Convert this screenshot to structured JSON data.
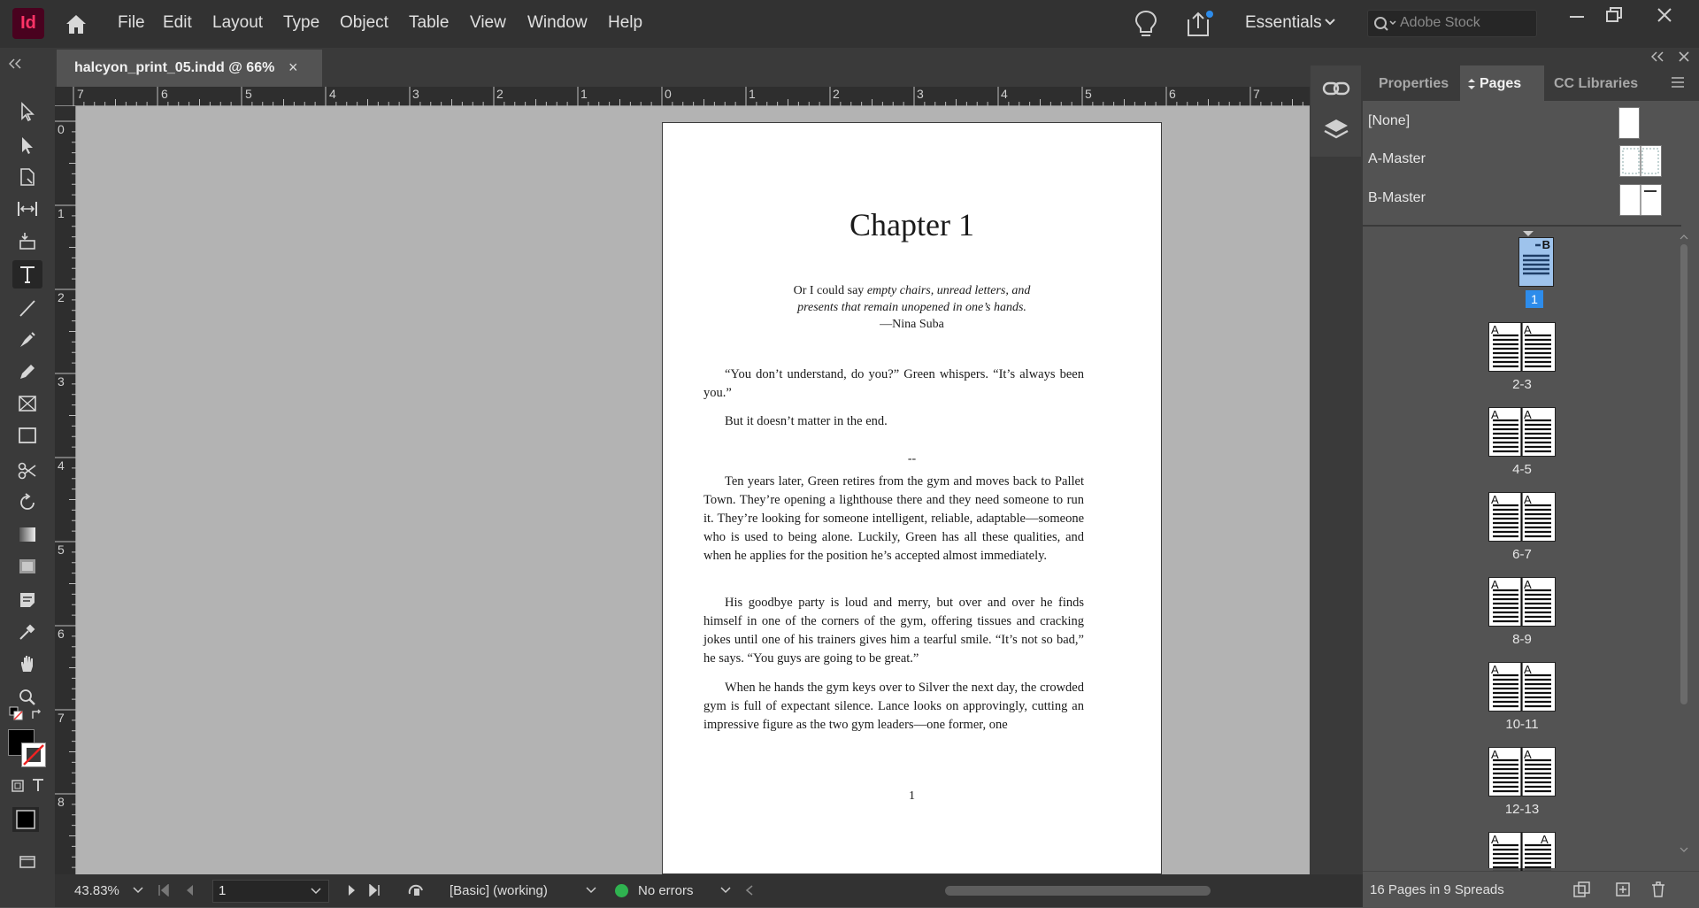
{
  "app": {
    "logo_text": "Id",
    "brand_color": "#ff3366"
  },
  "menu": [
    "File",
    "Edit",
    "Layout",
    "Type",
    "Object",
    "Table",
    "View",
    "Window",
    "Help"
  ],
  "workspace": "Essentials",
  "search": {
    "placeholder": "Adobe Stock"
  },
  "document_tab": {
    "title": "halcyon_print_05.indd @ 66%",
    "close": "×"
  },
  "ruler": {
    "horizontal": [
      "7",
      "6",
      "5",
      "4",
      "3",
      "2",
      "1",
      "0",
      "1",
      "2",
      "3",
      "4",
      "5",
      "6",
      "7"
    ],
    "vertical": [
      "0",
      "1",
      "2",
      "3",
      "4",
      "5",
      "6",
      "7",
      "8"
    ]
  },
  "page": {
    "chapter_title": "Chapter 1",
    "epigraph": {
      "line1_plain": "Or I could say ",
      "line1_italic": "empty chairs, unread letters, and",
      "line2_italic": "presents that remain  unopened in one’s hands.",
      "attribution": "—Nina Suba"
    },
    "paragraphs": [
      "“You don’t understand, do you?” Green whispers. “It’s always been you.”",
      "But it doesn’t matter in the end.",
      "Ten years later, Green retires from the gym and moves back to Pallet Town. They’re opening a lighthouse there and they need someone to run it. They’re looking for someone intelligent, reliable, adaptable—someone who is used to being alone. Luckily, Green has all these qualities, and when he applies for the position he’s accepted almost immediately.",
      "His goodbye party is loud and merry, but over and over he finds himself in one of the corners of the gym, offering tissues and cracking jokes until one of his trainers gives him a tearful smile. “It’s not so bad,” he says. “You guys are going to be great.”",
      "When he hands the gym keys over to Silver the next day, the crowded gym is full of expectant silence. Lance looks on approvingly, cutting an impressive figure as the two gym leaders—one former, one"
    ],
    "separator": "--",
    "folio": "1"
  },
  "status": {
    "zoom": "43.83%",
    "page_number": "1",
    "style": "[Basic] (working)",
    "preflight": "No errors"
  },
  "panel": {
    "tabs": [
      "Properties",
      "Pages",
      "CC Libraries"
    ],
    "masters": [
      "[None]",
      "A-Master",
      "B-Master"
    ],
    "first_page": {
      "badge": "B",
      "label": "1"
    },
    "spreads": [
      "2-3",
      "4-5",
      "6-7",
      "8-9",
      "10-11",
      "12-13"
    ],
    "partial_spread_prefix": "A",
    "spread_prefix": "A",
    "footer": "16 Pages in 9 Spreads"
  }
}
